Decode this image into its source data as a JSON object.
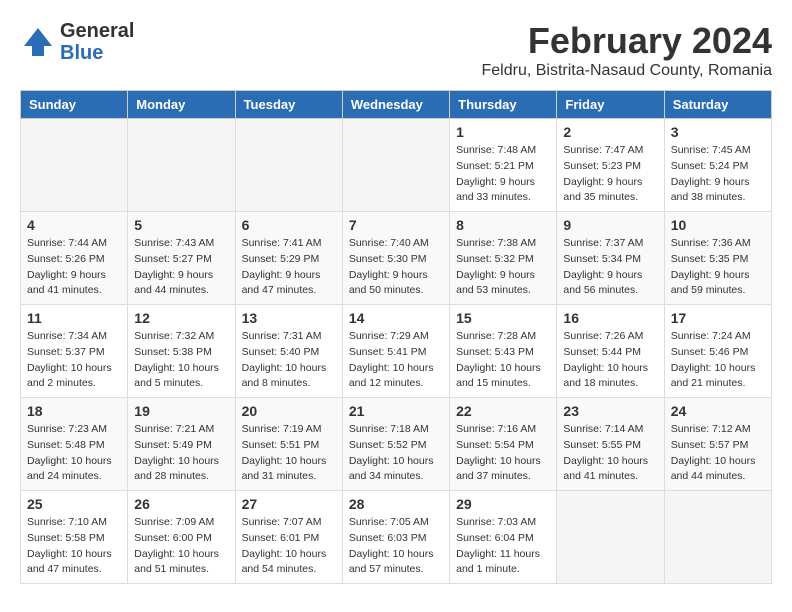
{
  "logo": {
    "general": "General",
    "blue": "Blue"
  },
  "header": {
    "title": "February 2024",
    "subtitle": "Feldru, Bistrita-Nasaud County, Romania"
  },
  "calendar": {
    "headers": [
      "Sunday",
      "Monday",
      "Tuesday",
      "Wednesday",
      "Thursday",
      "Friday",
      "Saturday"
    ],
    "weeks": [
      [
        {
          "day": "",
          "info": ""
        },
        {
          "day": "",
          "info": ""
        },
        {
          "day": "",
          "info": ""
        },
        {
          "day": "",
          "info": ""
        },
        {
          "day": "1",
          "info": "Sunrise: 7:48 AM\nSunset: 5:21 PM\nDaylight: 9 hours\nand 33 minutes."
        },
        {
          "day": "2",
          "info": "Sunrise: 7:47 AM\nSunset: 5:23 PM\nDaylight: 9 hours\nand 35 minutes."
        },
        {
          "day": "3",
          "info": "Sunrise: 7:45 AM\nSunset: 5:24 PM\nDaylight: 9 hours\nand 38 minutes."
        }
      ],
      [
        {
          "day": "4",
          "info": "Sunrise: 7:44 AM\nSunset: 5:26 PM\nDaylight: 9 hours\nand 41 minutes."
        },
        {
          "day": "5",
          "info": "Sunrise: 7:43 AM\nSunset: 5:27 PM\nDaylight: 9 hours\nand 44 minutes."
        },
        {
          "day": "6",
          "info": "Sunrise: 7:41 AM\nSunset: 5:29 PM\nDaylight: 9 hours\nand 47 minutes."
        },
        {
          "day": "7",
          "info": "Sunrise: 7:40 AM\nSunset: 5:30 PM\nDaylight: 9 hours\nand 50 minutes."
        },
        {
          "day": "8",
          "info": "Sunrise: 7:38 AM\nSunset: 5:32 PM\nDaylight: 9 hours\nand 53 minutes."
        },
        {
          "day": "9",
          "info": "Sunrise: 7:37 AM\nSunset: 5:34 PM\nDaylight: 9 hours\nand 56 minutes."
        },
        {
          "day": "10",
          "info": "Sunrise: 7:36 AM\nSunset: 5:35 PM\nDaylight: 9 hours\nand 59 minutes."
        }
      ],
      [
        {
          "day": "11",
          "info": "Sunrise: 7:34 AM\nSunset: 5:37 PM\nDaylight: 10 hours\nand 2 minutes."
        },
        {
          "day": "12",
          "info": "Sunrise: 7:32 AM\nSunset: 5:38 PM\nDaylight: 10 hours\nand 5 minutes."
        },
        {
          "day": "13",
          "info": "Sunrise: 7:31 AM\nSunset: 5:40 PM\nDaylight: 10 hours\nand 8 minutes."
        },
        {
          "day": "14",
          "info": "Sunrise: 7:29 AM\nSunset: 5:41 PM\nDaylight: 10 hours\nand 12 minutes."
        },
        {
          "day": "15",
          "info": "Sunrise: 7:28 AM\nSunset: 5:43 PM\nDaylight: 10 hours\nand 15 minutes."
        },
        {
          "day": "16",
          "info": "Sunrise: 7:26 AM\nSunset: 5:44 PM\nDaylight: 10 hours\nand 18 minutes."
        },
        {
          "day": "17",
          "info": "Sunrise: 7:24 AM\nSunset: 5:46 PM\nDaylight: 10 hours\nand 21 minutes."
        }
      ],
      [
        {
          "day": "18",
          "info": "Sunrise: 7:23 AM\nSunset: 5:48 PM\nDaylight: 10 hours\nand 24 minutes."
        },
        {
          "day": "19",
          "info": "Sunrise: 7:21 AM\nSunset: 5:49 PM\nDaylight: 10 hours\nand 28 minutes."
        },
        {
          "day": "20",
          "info": "Sunrise: 7:19 AM\nSunset: 5:51 PM\nDaylight: 10 hours\nand 31 minutes."
        },
        {
          "day": "21",
          "info": "Sunrise: 7:18 AM\nSunset: 5:52 PM\nDaylight: 10 hours\nand 34 minutes."
        },
        {
          "day": "22",
          "info": "Sunrise: 7:16 AM\nSunset: 5:54 PM\nDaylight: 10 hours\nand 37 minutes."
        },
        {
          "day": "23",
          "info": "Sunrise: 7:14 AM\nSunset: 5:55 PM\nDaylight: 10 hours\nand 41 minutes."
        },
        {
          "day": "24",
          "info": "Sunrise: 7:12 AM\nSunset: 5:57 PM\nDaylight: 10 hours\nand 44 minutes."
        }
      ],
      [
        {
          "day": "25",
          "info": "Sunrise: 7:10 AM\nSunset: 5:58 PM\nDaylight: 10 hours\nand 47 minutes."
        },
        {
          "day": "26",
          "info": "Sunrise: 7:09 AM\nSunset: 6:00 PM\nDaylight: 10 hours\nand 51 minutes."
        },
        {
          "day": "27",
          "info": "Sunrise: 7:07 AM\nSunset: 6:01 PM\nDaylight: 10 hours\nand 54 minutes."
        },
        {
          "day": "28",
          "info": "Sunrise: 7:05 AM\nSunset: 6:03 PM\nDaylight: 10 hours\nand 57 minutes."
        },
        {
          "day": "29",
          "info": "Sunrise: 7:03 AM\nSunset: 6:04 PM\nDaylight: 11 hours\nand 1 minute."
        },
        {
          "day": "",
          "info": ""
        },
        {
          "day": "",
          "info": ""
        }
      ]
    ]
  }
}
